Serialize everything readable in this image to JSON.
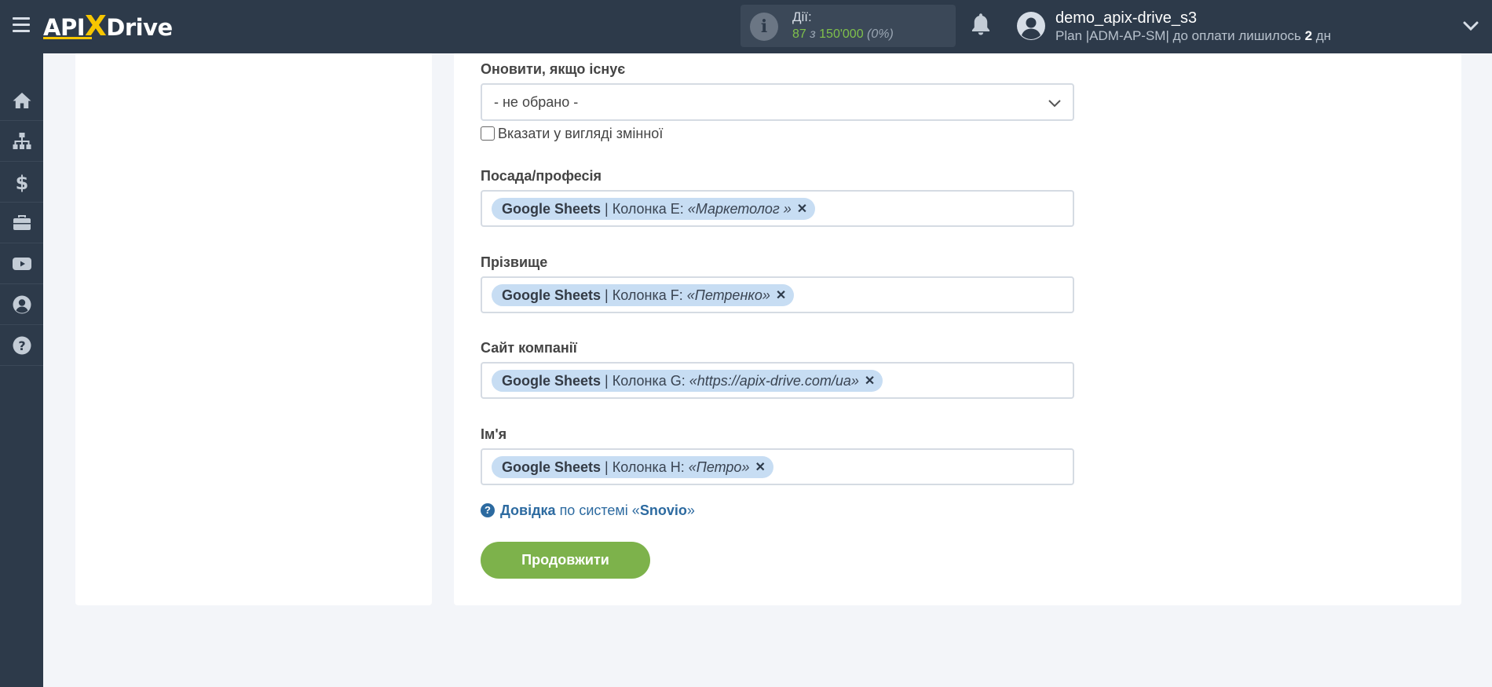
{
  "header": {
    "logo_text": "APIXDrive",
    "actions": {
      "title": "Дії:",
      "used": "87",
      "of_word": "з",
      "limit": "150'000",
      "percent": "(0%)"
    },
    "user": {
      "name": "demo_apix-drive_s3",
      "plan_prefix": "Plan |ADM-AP-SM| до оплати лишилось",
      "days": "2",
      "days_unit": "дн"
    }
  },
  "sidebar": {
    "items": [
      {
        "icon": "home-icon"
      },
      {
        "icon": "sitemap-icon"
      },
      {
        "icon": "dollar-icon"
      },
      {
        "icon": "briefcase-icon"
      },
      {
        "icon": "youtube-icon"
      },
      {
        "icon": "user-circle-icon"
      },
      {
        "icon": "help-circle-icon"
      }
    ]
  },
  "form": {
    "update_if_exists": {
      "label": "Оновити, якщо існує",
      "value": "- не обрано -",
      "checkbox_label": "Вказати у вигляді змінної"
    },
    "fields": [
      {
        "label": "Посада/професія",
        "source": "Google Sheets",
        "column": "Колонка E:",
        "value": "«Маркетолог »"
      },
      {
        "label": "Прізвище",
        "source": "Google Sheets",
        "column": "Колонка F:",
        "value": "«Петренко»"
      },
      {
        "label": "Сайт компанії",
        "source": "Google Sheets",
        "column": "Колонка G:",
        "value": "«https://apix-drive.com/ua»"
      },
      {
        "label": "Ім'я",
        "source": "Google Sheets",
        "column": "Колонка H:",
        "value": "«Петро»"
      }
    ],
    "help": {
      "link": "Довідка",
      "middle": "по системі «",
      "system": "Snovio",
      "end": "»"
    },
    "continue_label": "Продовжити"
  },
  "colors": {
    "topbar": "#2d3a4a",
    "accent_yellow": "#f7c600",
    "tag_bg": "#c7ddf3",
    "button_green": "#7db24b",
    "help_link": "#2c6aa0"
  }
}
